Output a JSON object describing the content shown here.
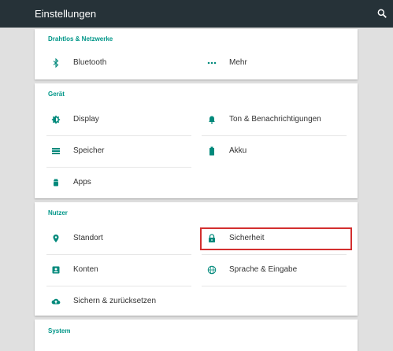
{
  "appbar": {
    "title": "Einstellungen",
    "search_icon": "search-icon"
  },
  "sections": {
    "wireless": {
      "header": "Drahtlos & Netzwerke",
      "bluetooth": "Bluetooth",
      "more": "Mehr"
    },
    "device": {
      "header": "Gerät",
      "display": "Display",
      "sound": "Ton & Benachrichtigungen",
      "storage": "Speicher",
      "battery": "Akku",
      "apps": "Apps"
    },
    "user": {
      "header": "Nutzer",
      "location": "Standort",
      "security": "Sicherheit",
      "accounts": "Konten",
      "language": "Sprache & Eingabe",
      "backup": "Sichern & zurücksetzen"
    },
    "system": {
      "header": "System"
    }
  },
  "colors": {
    "accent": "#009688",
    "appbar": "#263238",
    "highlight": "#d32f2f"
  }
}
